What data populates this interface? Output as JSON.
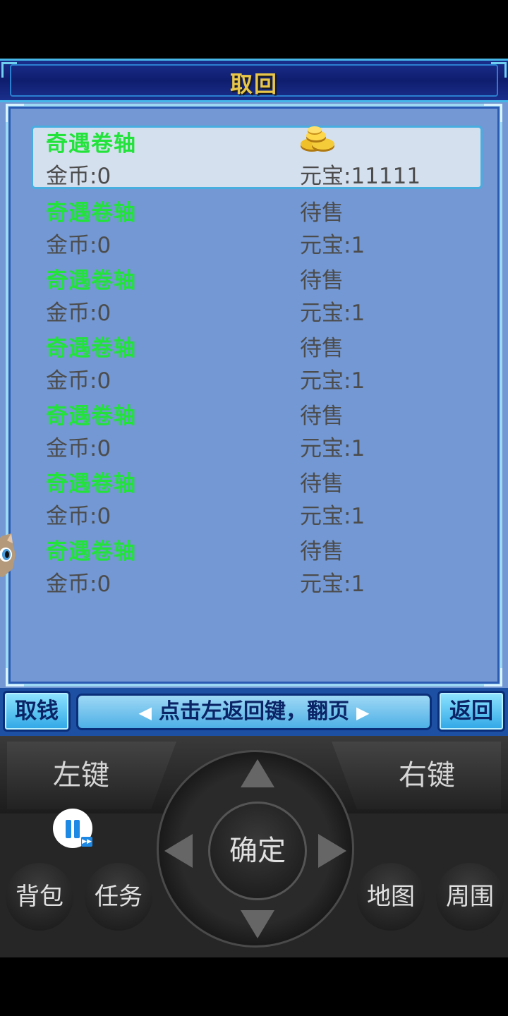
{
  "window": {
    "title": "取回"
  },
  "items": [
    {
      "name": "奇遇卷轴",
      "status": "",
      "gold": "金币:0",
      "ingot": "元宝:11111",
      "selected": true,
      "icon": "gold-ingots-icon"
    },
    {
      "name": "奇遇卷轴",
      "status": "待售",
      "gold": "金币:0",
      "ingot": "元宝:1"
    },
    {
      "name": "奇遇卷轴",
      "status": "待售",
      "gold": "金币:0",
      "ingot": "元宝:1"
    },
    {
      "name": "奇遇卷轴",
      "status": "待售",
      "gold": "金币:0",
      "ingot": "元宝:1"
    },
    {
      "name": "奇遇卷轴",
      "status": "待售",
      "gold": "金币:0",
      "ingot": "元宝:1"
    },
    {
      "name": "奇遇卷轴",
      "status": "待售",
      "gold": "金币:0",
      "ingot": "元宝:1"
    },
    {
      "name": "奇遇卷轴",
      "status": "待售",
      "gold": "金币:0",
      "ingot": "元宝:1"
    }
  ],
  "bottom_bar": {
    "left_button": "取钱",
    "hint": "点击左返回键，翻页",
    "right_button": "返回"
  },
  "controller": {
    "left_key": "左键",
    "right_key": "右键",
    "ok": "确定",
    "bag": "背包",
    "task": "任务",
    "map": "地图",
    "nearby": "周围"
  },
  "colors": {
    "item_name": "#22e33a",
    "title": "#e7c64a",
    "panel_bg": "#7398d3"
  }
}
